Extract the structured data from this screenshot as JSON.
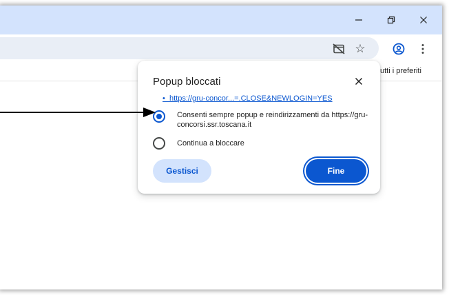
{
  "window_controls": {
    "minimize_icon": "minimize-icon",
    "restore_icon": "restore-icon",
    "close_icon": "close-icon"
  },
  "toolbar": {
    "popup_blocked_icon": "popup-blocked-icon",
    "bookmark_star_icon": "star-icon",
    "profile_icon": "profile-icon",
    "menu_icon": "more-vert-icon"
  },
  "bookmarks_bar": {
    "all_bookmarks_text": "utti i preferiti"
  },
  "popup_dialog": {
    "title": "Popup bloccati",
    "close_icon": "close-icon",
    "blocked_link": "https://gru-concor...=.CLOSE&NEWLOGIN=YES",
    "options": [
      {
        "label": "Consenti sempre popup e reindirizzamenti da https://gru-concorsi.ssr.toscana.it",
        "selected": true
      },
      {
        "label": "Continua a bloccare",
        "selected": false
      }
    ],
    "manage_button": "Gestisci",
    "done_button": "Fine"
  },
  "colors": {
    "title_bar": "#d3e3fd",
    "accent": "#0b57d0",
    "tonal_button": "#d3e3fd"
  }
}
